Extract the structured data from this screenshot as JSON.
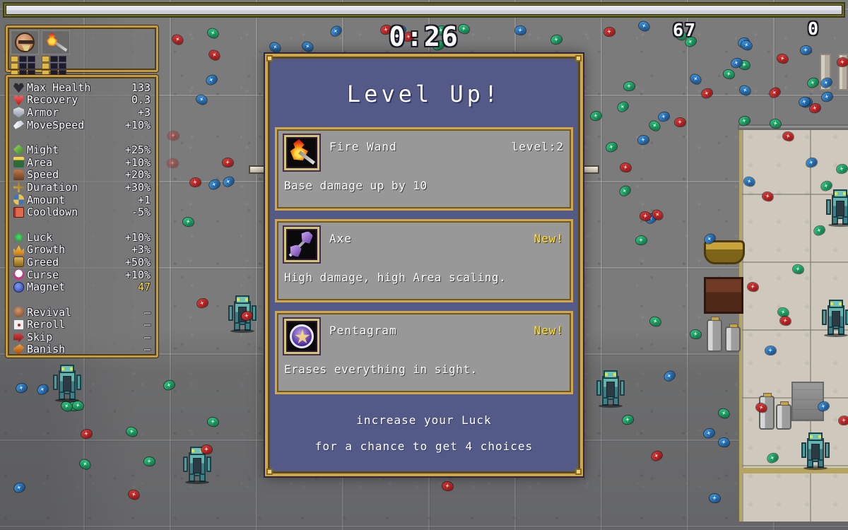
{
  "hud": {
    "xp_bar": {
      "name": "experience-bar",
      "fill_percent": 100
    },
    "timer": "0:26",
    "kill_count": "67",
    "coin_count": "0",
    "inventory": {
      "weapon_slots": [
        {
          "icon": "character-portrait-icon",
          "filled": true
        },
        {
          "icon": "fire-wand-icon",
          "filled": true
        }
      ],
      "weapon_grid_filled": [
        true,
        false,
        false,
        true,
        false,
        false,
        true,
        false,
        false
      ],
      "passive_grid_filled": [
        true,
        false,
        false,
        true,
        false,
        false,
        true,
        false,
        false
      ]
    }
  },
  "stats": {
    "group_a": [
      {
        "icon": "max-health-icon",
        "label": "Max Health",
        "value": "133"
      },
      {
        "icon": "recovery-icon",
        "label": "Recovery",
        "value": "0.3"
      },
      {
        "icon": "armor-icon",
        "label": "Armor",
        "value": "+3"
      },
      {
        "icon": "movespeed-icon",
        "label": "MoveSpeed",
        "value": "+10%"
      }
    ],
    "group_b": [
      {
        "icon": "might-icon",
        "label": "Might",
        "value": "+25%"
      },
      {
        "icon": "area-icon",
        "label": "Area",
        "value": "+10%"
      },
      {
        "icon": "speed-icon",
        "label": "Speed",
        "value": "+20%"
      },
      {
        "icon": "duration-icon",
        "label": "Duration",
        "value": "+30%"
      },
      {
        "icon": "amount-icon",
        "label": "Amount",
        "value": "+1"
      },
      {
        "icon": "cooldown-icon",
        "label": "Cooldown",
        "value": "-5%"
      }
    ],
    "group_c": [
      {
        "icon": "luck-icon",
        "label": "Luck",
        "value": "+10%"
      },
      {
        "icon": "growth-icon",
        "label": "Growth",
        "value": "+3%"
      },
      {
        "icon": "greed-icon",
        "label": "Greed",
        "value": "+50%"
      },
      {
        "icon": "curse-icon",
        "label": "Curse",
        "value": "+10%"
      },
      {
        "icon": "magnet-icon",
        "label": "Magnet",
        "value": "47",
        "highlight": true
      }
    ],
    "group_d": [
      {
        "icon": "revival-icon",
        "label": "Revival",
        "value": "–"
      },
      {
        "icon": "reroll-icon",
        "label": "Reroll",
        "value": "–"
      },
      {
        "icon": "skip-icon",
        "label": "Skip",
        "value": "–"
      },
      {
        "icon": "banish-icon",
        "label": "Banish",
        "value": "–"
      }
    ]
  },
  "levelup": {
    "title": "Level Up!",
    "choices": [
      {
        "icon": "fire-wand-icon",
        "name": "Fire Wand",
        "badge": "level:2",
        "is_new": false,
        "description": "Base damage up by 10"
      },
      {
        "icon": "axe-icon",
        "name": "Axe",
        "badge": "New!",
        "is_new": true,
        "description": "High damage, high Area scaling."
      },
      {
        "icon": "pentagram-icon",
        "name": "Pentagram",
        "badge": "New!",
        "is_new": true,
        "description": "Erases everything in sight."
      }
    ],
    "footer_lines": [
      "increase your Luck",
      "for a chance to get 4 choices"
    ]
  },
  "colors": {
    "panel_border_gold": "#d2a64a",
    "dialog_bg": "#545a87",
    "card_bg": "#989898",
    "accent_yellow": "#ffe03c",
    "text_white": "#ffffff"
  }
}
